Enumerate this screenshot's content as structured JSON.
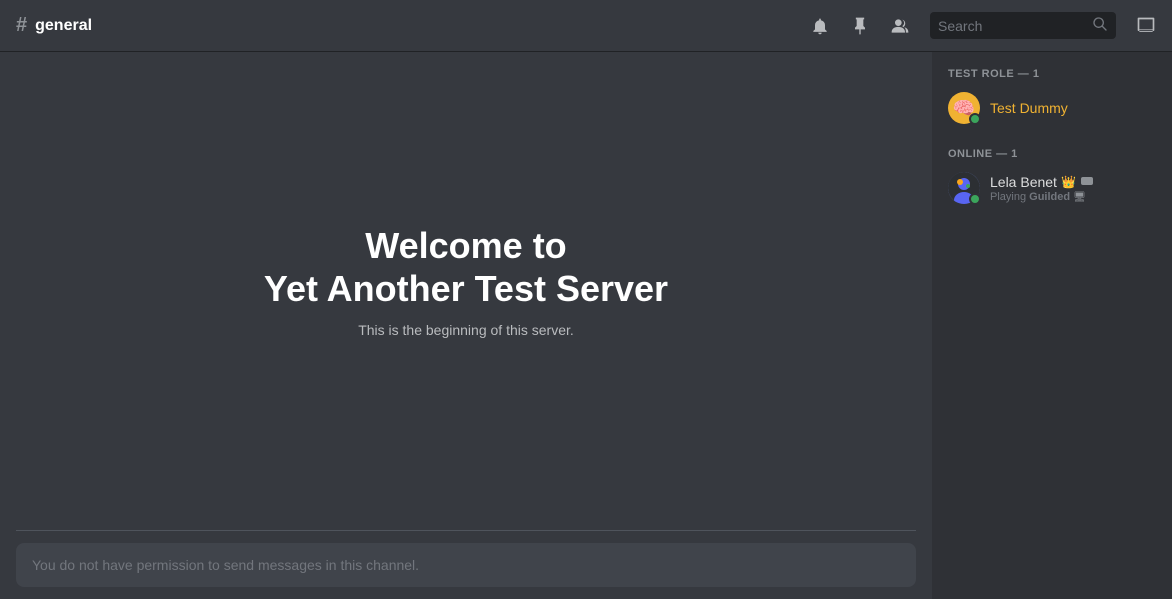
{
  "header": {
    "channel_icon": "#",
    "channel_name": "general",
    "actions": {
      "notifications_label": "Notification Settings",
      "pin_label": "Pinned Messages",
      "members_label": "Member List",
      "search_placeholder": "Search",
      "inbox_label": "Inbox"
    }
  },
  "chat": {
    "welcome_title_line1": "Welcome to",
    "welcome_title_line2": "Yet Another Test Server",
    "welcome_subtitle": "This is the beginning of this server.",
    "input_placeholder": "You do not have permission to send messages in this channel."
  },
  "members_sidebar": {
    "categories": [
      {
        "label": "TEST ROLE — 1",
        "members": [
          {
            "name": "Test Dummy",
            "name_color": "#f0b232",
            "avatar_emoji": "🧠",
            "avatar_bg": "#f0b232",
            "status": "online",
            "status_text": ""
          }
        ]
      },
      {
        "label": "ONLINE — 1",
        "members": [
          {
            "name": "Lela Benet",
            "name_color": "#dcddde",
            "avatar_type": "image",
            "status": "online",
            "status_text": "Playing Guilded",
            "has_crown": true,
            "has_nitro": true
          }
        ]
      }
    ]
  }
}
